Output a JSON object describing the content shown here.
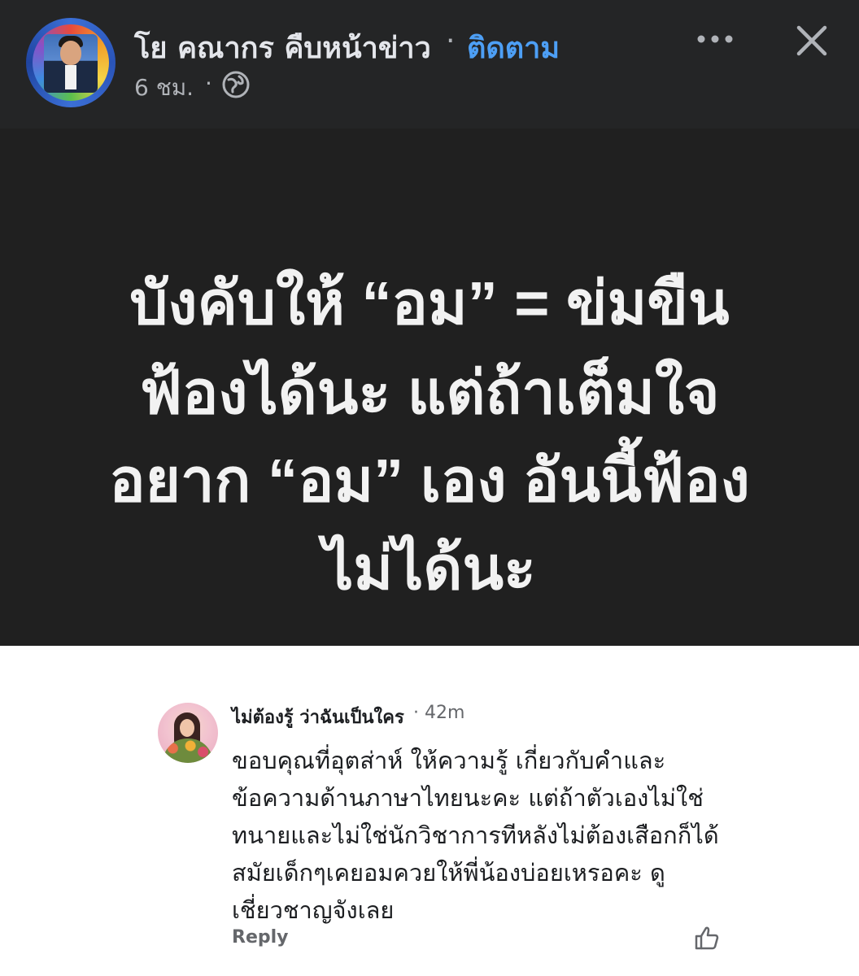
{
  "header": {
    "page_name": "โย คณากร คืบหน้าข่าว",
    "separator": "·",
    "follow_label": "ติดตาม",
    "timestamp": "6 ชม.",
    "timestamp_separator": "·",
    "privacy_icon": "globe-icon",
    "more_icon": "more-horizontal-icon",
    "close_icon": "close-icon"
  },
  "post_image": {
    "lines": [
      "บังคับให้ “อม” = ข่มขืน",
      "ฟ้องได้นะ แต่ถ้าเต็มใจ",
      "อยาก “อม” เอง อันนี้ฟ้อง",
      "ไม่ได้นะ"
    ],
    "background": "#202020",
    "text_color": "#f2f2f2"
  },
  "comment": {
    "author": "ไม่ต้องรู้ ว่าฉันเป็นใคร",
    "time": "· 42m",
    "lines": [
      "ขอบคุณที่อุตส่าห์ ให้ความรู้ เกี่ยวกับคำและ",
      "ข้อความด้านภาษาไทยนะคะ แต่ถ้าตัวเองไม่ใช่",
      "ทนายและไม่ใช่นักวิชาการทีหลังไม่ต้องเสือกก็ได้",
      "สมัยเด็กๆเคยอมควยให้พี่น้องบ่อยเหรอคะ ดู",
      "เชี่ยวชาญจังเลย"
    ],
    "reply_label": "Reply",
    "like_icon": "thumbs-up-icon"
  },
  "colors": {
    "header_bg": "#242526",
    "link_blue": "#4d9ff5",
    "muted": "#b0b3b8"
  }
}
